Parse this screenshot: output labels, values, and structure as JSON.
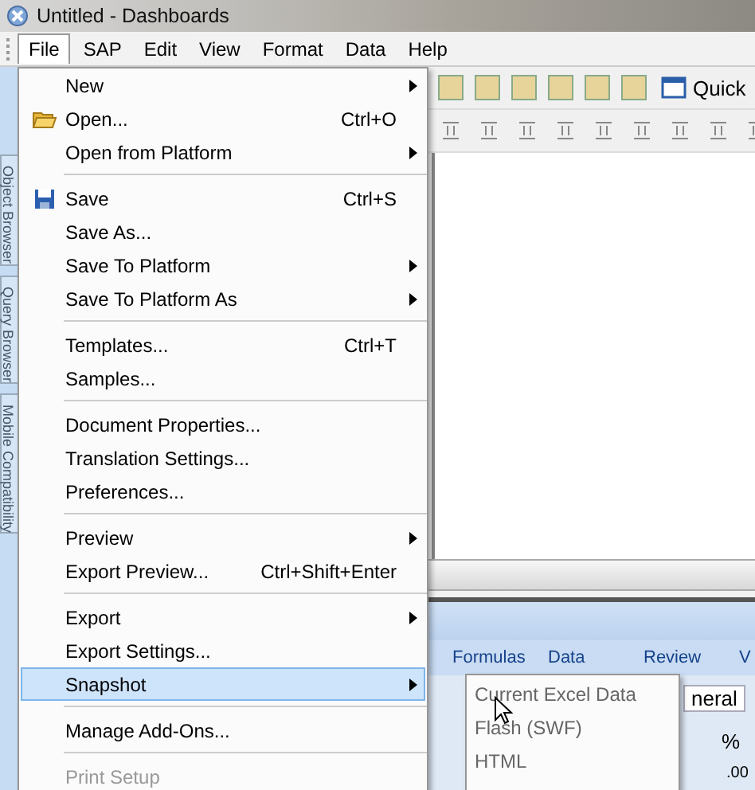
{
  "window": {
    "title": "Untitled - Dashboards"
  },
  "menubar": [
    {
      "label": "File",
      "selected": true
    },
    {
      "label": "SAP",
      "selected": false
    },
    {
      "label": "Edit",
      "selected": false
    },
    {
      "label": "View",
      "selected": false
    },
    {
      "label": "Format",
      "selected": false
    },
    {
      "label": "Data",
      "selected": false
    },
    {
      "label": "Help",
      "selected": false
    }
  ],
  "toolbar": {
    "quick_button": "Quick"
  },
  "side_tabs": [
    "Object Browser",
    "Query Browser",
    "Mobile Compatibility"
  ],
  "file_menu": {
    "groups": [
      [
        {
          "label": "New",
          "submenu": true,
          "selected": false,
          "disabled": false
        },
        {
          "label": "Open...",
          "shortcut": "Ctrl+O",
          "submenu": false,
          "selected": false,
          "disabled": false
        },
        {
          "label": "Open from Platform",
          "submenu": true,
          "selected": false,
          "disabled": false
        }
      ],
      [
        {
          "label": "Save",
          "shortcut": "Ctrl+S",
          "submenu": false,
          "selected": false,
          "disabled": false
        },
        {
          "label": "Save As...",
          "submenu": false,
          "selected": false,
          "disabled": false
        },
        {
          "label": "Save To Platform",
          "submenu": true,
          "selected": false,
          "disabled": false
        },
        {
          "label": "Save To Platform As",
          "submenu": true,
          "selected": false,
          "disabled": false
        }
      ],
      [
        {
          "label": "Templates...",
          "shortcut": "Ctrl+T",
          "submenu": false,
          "selected": false,
          "disabled": false
        },
        {
          "label": "Samples...",
          "submenu": false,
          "selected": false,
          "disabled": false
        }
      ],
      [
        {
          "label": "Document Properties...",
          "submenu": false,
          "selected": false,
          "disabled": false
        },
        {
          "label": "Translation Settings...",
          "submenu": false,
          "selected": false,
          "disabled": false
        },
        {
          "label": "Preferences...",
          "submenu": false,
          "selected": false,
          "disabled": false
        }
      ],
      [
        {
          "label": "Preview",
          "submenu": true,
          "selected": false,
          "disabled": false
        },
        {
          "label": "Export Preview...",
          "shortcut": "Ctrl+Shift+Enter",
          "submenu": false,
          "selected": false,
          "disabled": false
        }
      ],
      [
        {
          "label": "Export",
          "submenu": true,
          "selected": false,
          "disabled": false
        },
        {
          "label": "Export Settings...",
          "submenu": false,
          "selected": false,
          "disabled": false
        },
        {
          "label": "Snapshot",
          "submenu": true,
          "selected": true,
          "disabled": false
        }
      ],
      [
        {
          "label": "Manage Add-Ons...",
          "submenu": false,
          "selected": false,
          "disabled": false
        }
      ],
      [
        {
          "label": "Print Setup",
          "submenu": false,
          "selected": false,
          "disabled": true
        }
      ]
    ]
  },
  "snapshot_menu": [
    {
      "label": "Current Excel Data"
    },
    {
      "label": "Flash (SWF)"
    },
    {
      "label": "HTML"
    }
  ],
  "spreadsheet": {
    "ribbon_tabs": [
      "Formulas",
      "Data",
      "Review",
      "V"
    ],
    "number_format": "neral",
    "percent": "%",
    "decimals": ".00"
  }
}
